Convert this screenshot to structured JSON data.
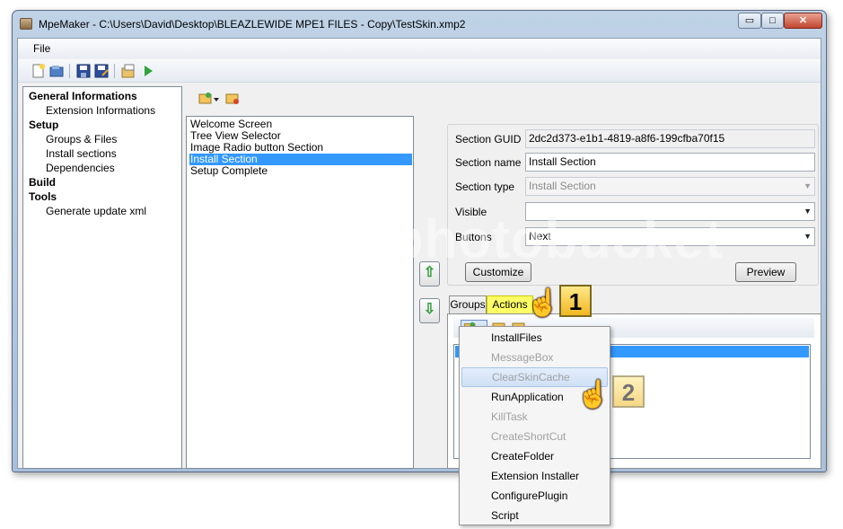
{
  "window": {
    "title": "MpeMaker - C:\\Users\\David\\Desktop\\BLEAZLEWIDE MPE1 FILES - Copy\\TestSkin.xmp2",
    "min_glyph": "▭",
    "max_glyph": "□",
    "close_glyph": "✕"
  },
  "menu": {
    "file": "File"
  },
  "toolbar": {
    "icons": [
      "new-icon",
      "open-icon",
      "save-icon",
      "save-as-icon",
      "pack-icon",
      "run-icon"
    ]
  },
  "tree": {
    "items": [
      {
        "label": "General Informations",
        "level": 0
      },
      {
        "label": "Extension Informations",
        "level": 1
      },
      {
        "label": "Setup",
        "level": 0
      },
      {
        "label": "Groups & Files",
        "level": 1
      },
      {
        "label": "Install sections",
        "level": 1
      },
      {
        "label": "Dependencies",
        "level": 1
      },
      {
        "label": "Build",
        "level": 0
      },
      {
        "label": "Tools",
        "level": 0
      },
      {
        "label": "Generate update xml",
        "level": 1
      }
    ]
  },
  "sections": {
    "items": [
      "Welcome Screen",
      "Tree View Selector",
      "Image Radio button Section",
      "Install Section",
      "Setup Complete"
    ],
    "selected": "Install Section"
  },
  "arrows": {
    "up": "⇧",
    "down": "⇩"
  },
  "details": {
    "guid_label": "Section GUID",
    "guid_value": "2dc2d373-e1b1-4819-a8f6-199cfba70f15",
    "name_label": "Section name",
    "name_value": "Install Section",
    "type_label": "Section type",
    "type_value": "Install Section",
    "visible_label": "Visible",
    "visible_value": "",
    "buttons_label": "Buttons",
    "buttons_value": "Next",
    "customize": "Customize",
    "preview": "Preview"
  },
  "tabs": {
    "groups": "Groups",
    "actions": "Actions"
  },
  "context_menu": {
    "items": [
      {
        "label": "InstallFiles",
        "enabled": true
      },
      {
        "label": "MessageBox",
        "enabled": false
      },
      {
        "label": "ClearSkinCache",
        "enabled": false,
        "hover": true
      },
      {
        "label": "RunApplication",
        "enabled": true
      },
      {
        "label": "KillTask",
        "enabled": false
      },
      {
        "label": "CreateShortCut",
        "enabled": false
      },
      {
        "label": "CreateFolder",
        "enabled": true
      },
      {
        "label": "Extension Installer",
        "enabled": true
      },
      {
        "label": "ConfigurePlugin",
        "enabled": true
      },
      {
        "label": "Script",
        "enabled": true
      }
    ]
  },
  "callouts": {
    "one": "1",
    "two": "2"
  },
  "watermark": "photobucket",
  "hand_glyph": "☝",
  "colors": {
    "selection": "#3399ff",
    "callout": "#f0b722",
    "actions_tab": "#ffff66"
  }
}
